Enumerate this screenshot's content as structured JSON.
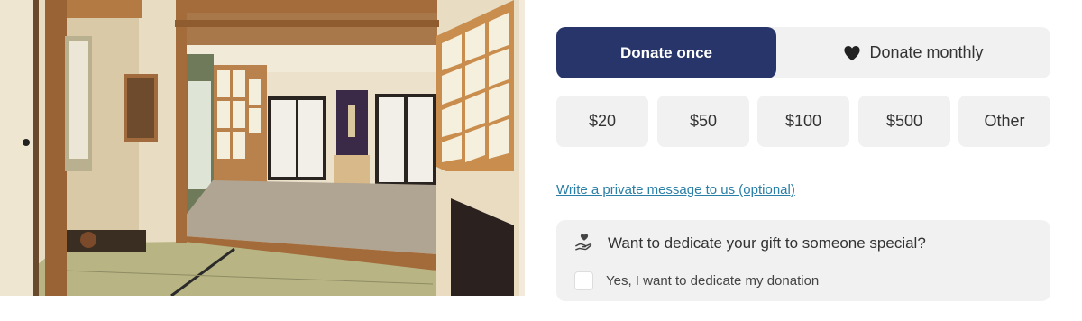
{
  "hero": {
    "image": "japanese-room-interior"
  },
  "donation": {
    "frequency": {
      "once_label": "Donate once",
      "monthly_label": "Donate monthly",
      "selected": "once",
      "monthly_icon": "heart-icon"
    },
    "amounts": [
      "$20",
      "$50",
      "$100",
      "$500",
      "Other"
    ],
    "private_message_link": "Write a private message to us (optional)",
    "dedicate": {
      "icon": "hand-heart-icon",
      "title": "Want to dedicate your gift to someone special?",
      "checkbox_label": "Yes, I want to dedicate my donation",
      "checked": false
    },
    "colors": {
      "primary": "#28356a",
      "button_bg": "#f1f1f1",
      "link": "#2a7fa6",
      "text": "#333333"
    }
  }
}
